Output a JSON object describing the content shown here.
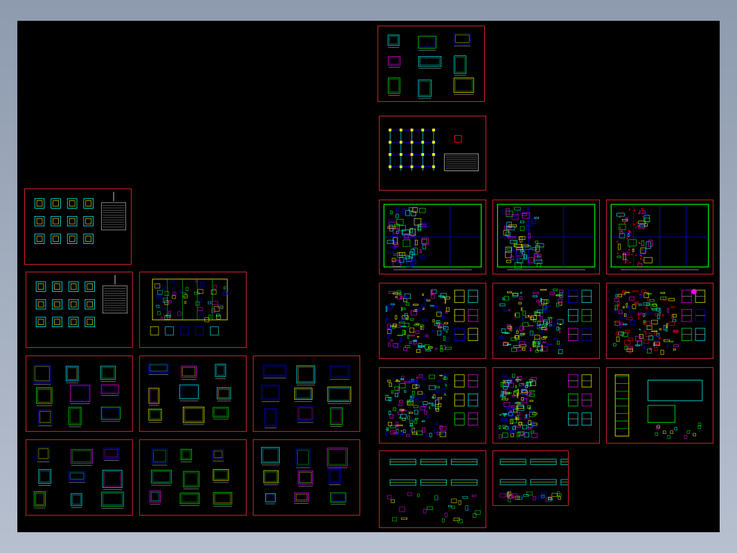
{
  "app": {
    "view": "cad-model-space",
    "background_color": "#000000",
    "frame_color": "#d0202a",
    "line_colors": [
      "#ffff00",
      "#00ff00",
      "#00ffff",
      "#0000ff",
      "#ff00ff",
      "#ff0000",
      "#ffffff"
    ]
  },
  "sheets": [
    {
      "id": "s01",
      "style": "detail"
    },
    {
      "id": "s02",
      "style": "grid"
    },
    {
      "id": "s03",
      "style": "siteplan"
    },
    {
      "id": "s04",
      "style": "siteplan"
    },
    {
      "id": "s05",
      "style": "siteplan-sparse"
    },
    {
      "id": "s06",
      "style": "dense-detail"
    },
    {
      "id": "s07",
      "style": "dense-detail"
    },
    {
      "id": "s08",
      "style": "dense-red"
    },
    {
      "id": "s09",
      "style": "dense-detail"
    },
    {
      "id": "s10",
      "style": "mixed"
    },
    {
      "id": "s11",
      "style": "tall"
    },
    {
      "id": "s12",
      "style": "beams"
    },
    {
      "id": "s13",
      "style": "beams"
    },
    {
      "id": "s14",
      "style": "cluster"
    },
    {
      "id": "s15",
      "style": "cluster"
    },
    {
      "id": "s16",
      "style": "plan"
    },
    {
      "id": "s17",
      "style": "detail"
    },
    {
      "id": "s18",
      "style": "detail"
    },
    {
      "id": "s19",
      "style": "detail"
    },
    {
      "id": "s20",
      "style": "detail"
    },
    {
      "id": "s21",
      "style": "detail"
    },
    {
      "id": "s22",
      "style": "detail"
    },
    {
      "id": "s23",
      "style": "detail"
    }
  ]
}
